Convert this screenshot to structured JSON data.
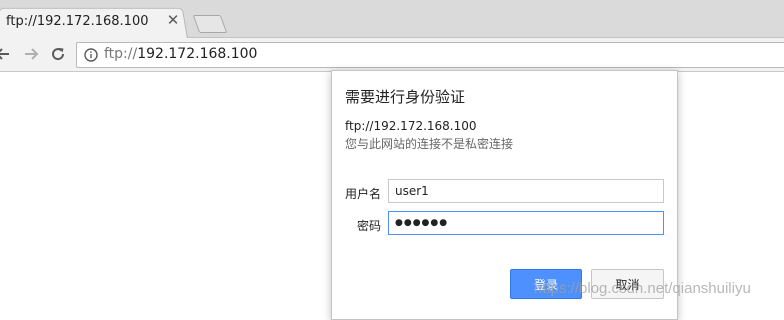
{
  "browser": {
    "tab": {
      "title": "ftp://192.172.168.100",
      "close_icon": "close-icon"
    },
    "toolbar": {
      "back_icon": "back-arrow-icon",
      "forward_icon": "forward-arrow-icon",
      "reload_icon": "reload-icon",
      "info_icon": "info-icon"
    },
    "omnibox": {
      "scheme": "ftp://",
      "host": "192.172.168.100"
    }
  },
  "auth_dialog": {
    "title": "需要进行身份验证",
    "origin": "ftp://192.172.168.100",
    "warning": "您与此网站的连接不是私密连接",
    "username_label": "用户名",
    "username_value": "user1",
    "password_label": "密码",
    "password_mask": "●●●●●●",
    "login_button": "登录",
    "cancel_button": "取消"
  },
  "watermark": "https://blog.csdn.net/qianshuiliyu",
  "colors": {
    "primary_button": "#4d90fe",
    "focus_border": "#4d90fe",
    "tabstrip": "#dadada"
  }
}
